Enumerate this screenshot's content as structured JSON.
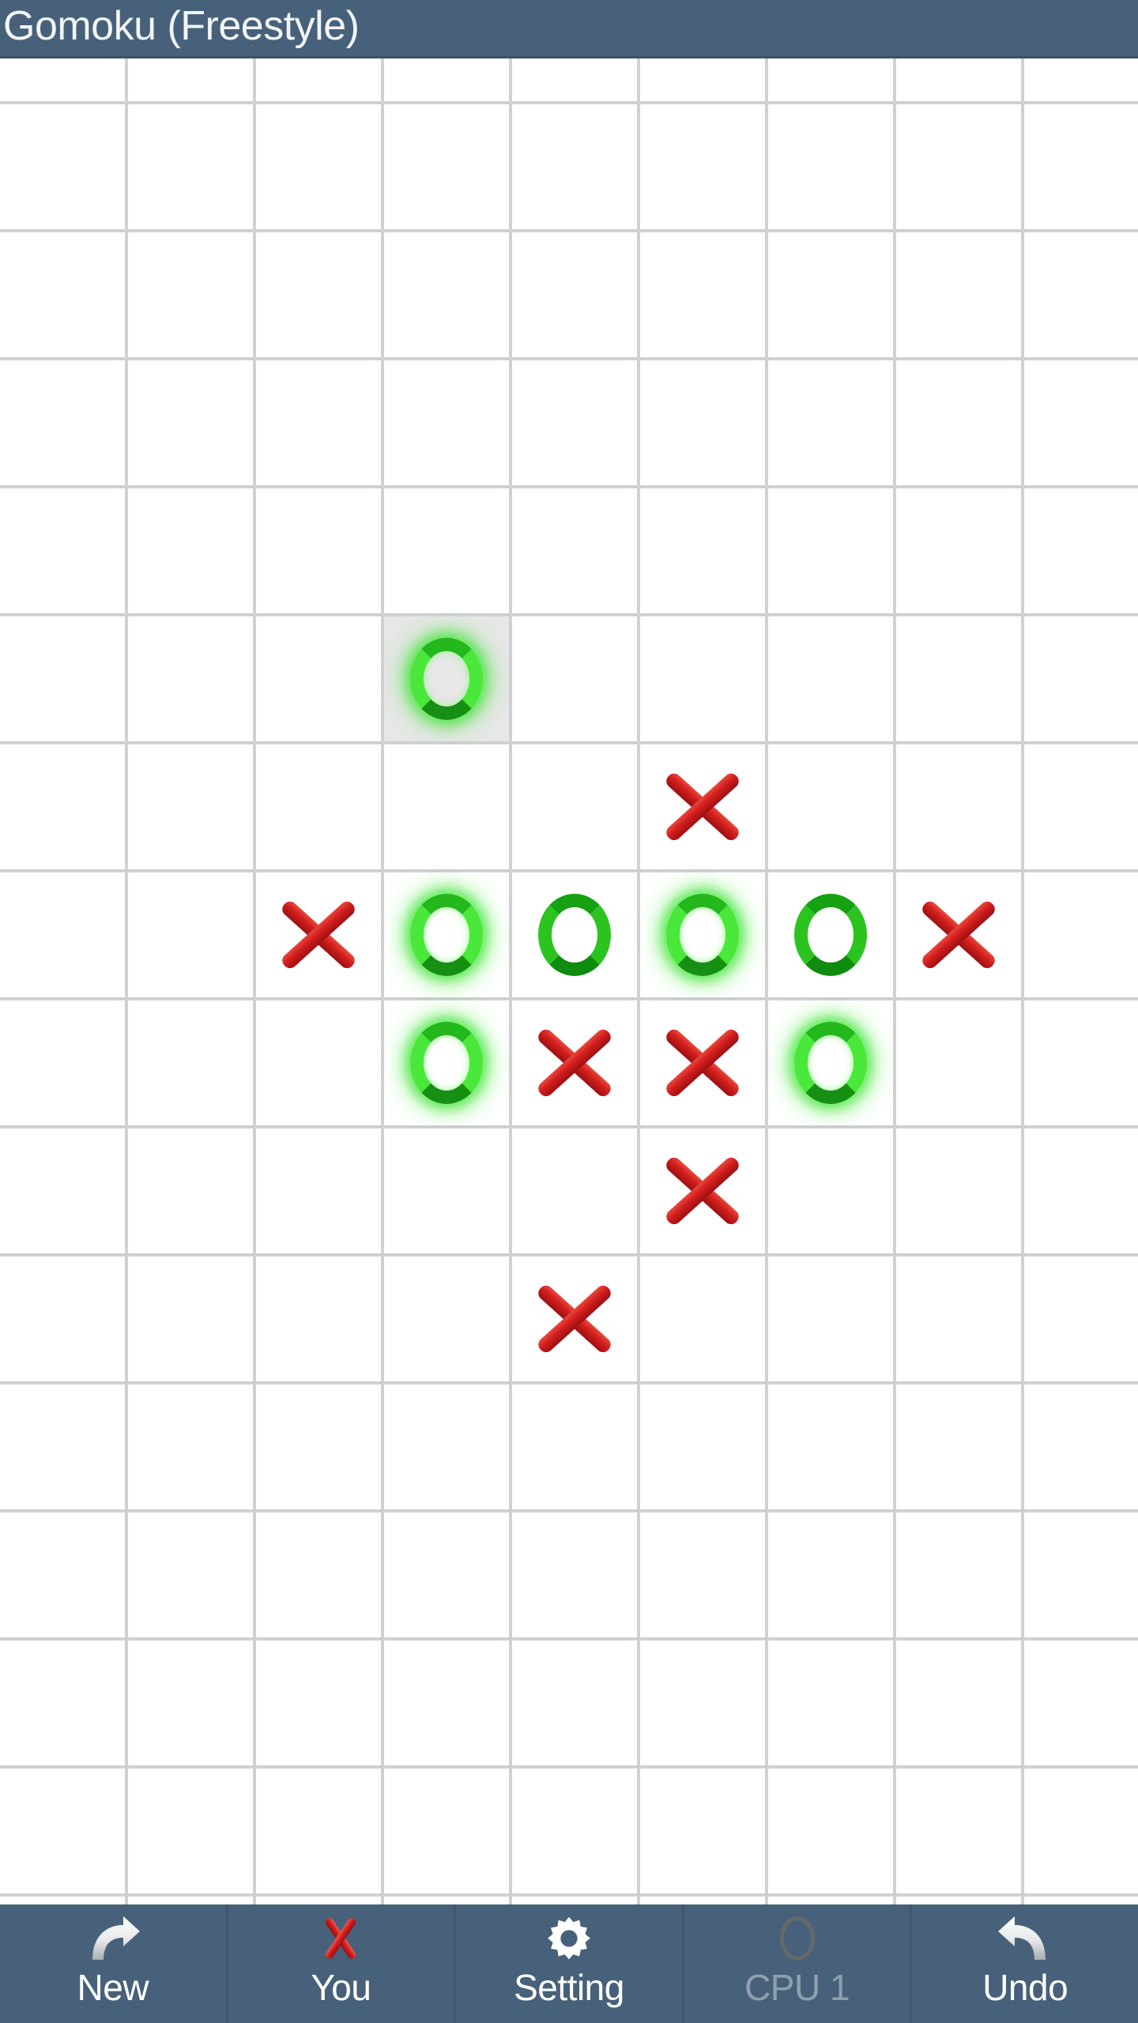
{
  "app": {
    "title": "Gomoku (Freestyle)",
    "title_bar_color": "#47617a",
    "toolbar_color": "#47617a",
    "board_background": "#ffffff",
    "grid_line_color": "#d0d0d4",
    "highlight_cell_color": "#e7e7e7",
    "o_color": "#15a112",
    "o_glow_color": "#49e83a",
    "x_color": "#c81f1f"
  },
  "board": {
    "columns": 10,
    "rows": 16,
    "cell_size": 162,
    "highlight_cell": {
      "col": 3,
      "row": 5
    },
    "pieces": [
      {
        "col": 3,
        "row": 5,
        "mark": "O",
        "glow": true
      },
      {
        "col": 5,
        "row": 6,
        "mark": "X",
        "glow": false
      },
      {
        "col": 2,
        "row": 7,
        "mark": "X",
        "glow": false
      },
      {
        "col": 3,
        "row": 7,
        "mark": "O",
        "glow": true
      },
      {
        "col": 4,
        "row": 7,
        "mark": "O",
        "glow": false
      },
      {
        "col": 5,
        "row": 7,
        "mark": "O",
        "glow": true
      },
      {
        "col": 6,
        "row": 7,
        "mark": "O",
        "glow": false
      },
      {
        "col": 7,
        "row": 7,
        "mark": "X",
        "glow": false
      },
      {
        "col": 3,
        "row": 8,
        "mark": "O",
        "glow": true
      },
      {
        "col": 4,
        "row": 8,
        "mark": "X",
        "glow": false
      },
      {
        "col": 5,
        "row": 8,
        "mark": "X",
        "glow": false
      },
      {
        "col": 6,
        "row": 8,
        "mark": "O",
        "glow": true
      },
      {
        "col": 5,
        "row": 9,
        "mark": "X",
        "glow": false
      },
      {
        "col": 4,
        "row": 10,
        "mark": "X",
        "glow": false
      }
    ]
  },
  "toolbar": {
    "buttons": [
      {
        "label": "New",
        "icon": "redo-arrow-icon",
        "disabled": false
      },
      {
        "label": "You",
        "icon": "x-mark-icon",
        "disabled": false
      },
      {
        "label": "Setting",
        "icon": "gear-icon",
        "disabled": false
      },
      {
        "label": "CPU 1",
        "icon": "o-mark-icon",
        "disabled": true
      },
      {
        "label": "Undo",
        "icon": "undo-arrow-icon",
        "disabled": false
      }
    ]
  }
}
